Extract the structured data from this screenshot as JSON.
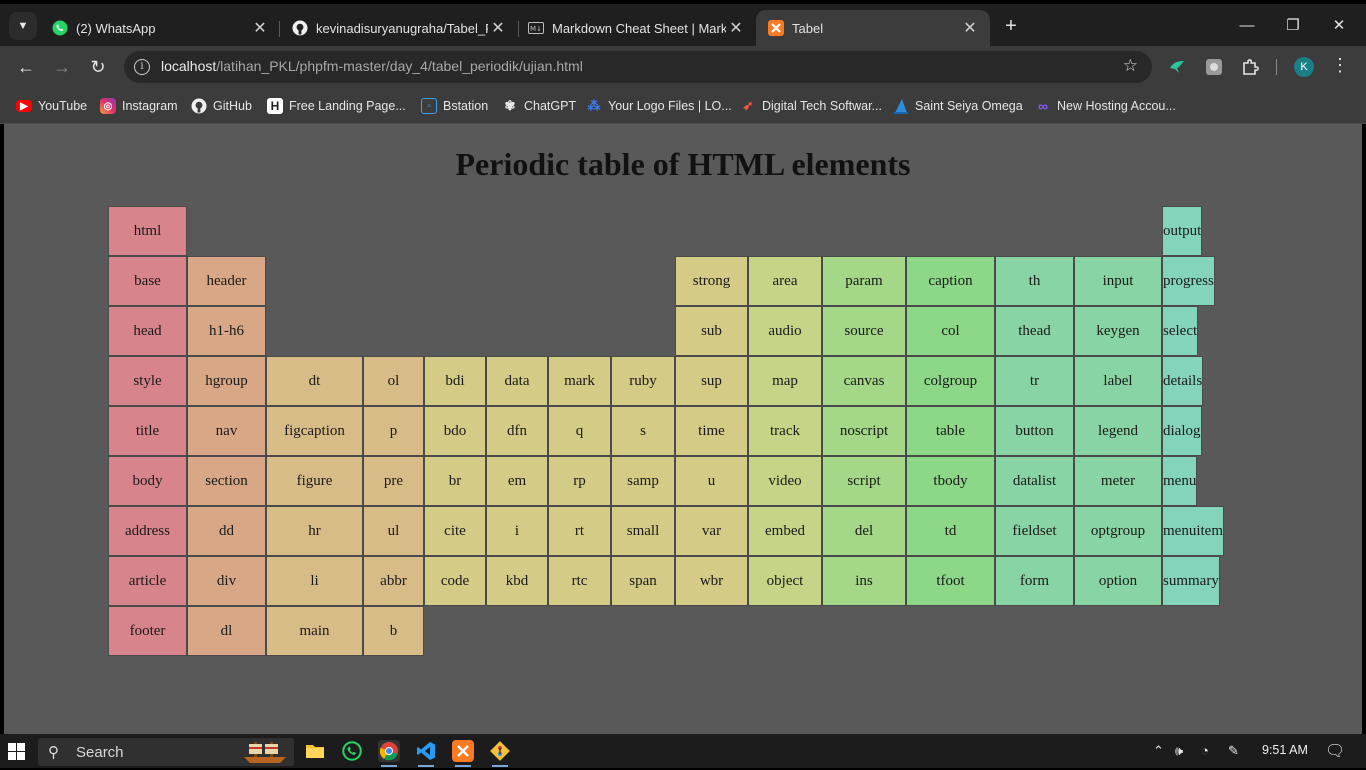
{
  "browser": {
    "tabs": [
      {
        "title": "(2) WhatsApp",
        "icon": "whatsapp-icon",
        "active": false
      },
      {
        "title": "kevinadisuryanugraha/Tabel_Pe",
        "icon": "github-icon",
        "active": false
      },
      {
        "title": "Markdown Cheat Sheet | Markd",
        "icon": "markdown-icon",
        "active": false
      },
      {
        "title": "Tabel",
        "icon": "xampp-icon",
        "active": true
      }
    ],
    "url_host": "localhost",
    "url_path": "/latihan_PKL/phpfm-master/day_4/tabel_periodik/ujian.html",
    "profile_initial": "K",
    "bookmarks": [
      {
        "label": "YouTube",
        "icon": "youtube-icon"
      },
      {
        "label": "Instagram",
        "icon": "instagram-icon"
      },
      {
        "label": "GitHub",
        "icon": "github-icon"
      },
      {
        "label": "Free Landing Page...",
        "icon": "h-icon"
      },
      {
        "label": "Bstation",
        "icon": "bstation-icon"
      },
      {
        "label": "ChatGPT",
        "icon": "chatgpt-icon"
      },
      {
        "label": "Your Logo Files | LO...",
        "icon": "logo-files-icon"
      },
      {
        "label": "Digital Tech Softwar...",
        "icon": "rocket-icon"
      },
      {
        "label": "Saint Seiya Omega",
        "icon": "sail-icon"
      },
      {
        "label": "New Hosting Accou...",
        "icon": "infinity-icon"
      }
    ]
  },
  "page": {
    "title": "Periodic table of HTML elements",
    "elements": [
      {
        "label": "html",
        "col": 0,
        "row": 0
      },
      {
        "label": "output",
        "col": 13,
        "row": 0
      },
      {
        "label": "base",
        "col": 0,
        "row": 1
      },
      {
        "label": "header",
        "col": 1,
        "row": 1
      },
      {
        "label": "strong",
        "col": 8,
        "row": 1
      },
      {
        "label": "area",
        "col": 9,
        "row": 1
      },
      {
        "label": "param",
        "col": 10,
        "row": 1
      },
      {
        "label": "caption",
        "col": 11,
        "row": 1
      },
      {
        "label": "th",
        "col": 12,
        "row": 1
      },
      {
        "label": "input",
        "col": 12.5,
        "row": 1
      },
      {
        "label": "progress",
        "col": 13,
        "row": 1
      },
      {
        "label": "head",
        "col": 0,
        "row": 2
      },
      {
        "label": "h1-h6",
        "col": 1,
        "row": 2
      },
      {
        "label": "sub",
        "col": 8,
        "row": 2
      },
      {
        "label": "audio",
        "col": 9,
        "row": 2
      },
      {
        "label": "source",
        "col": 10,
        "row": 2
      },
      {
        "label": "col",
        "col": 11,
        "row": 2
      },
      {
        "label": "thead",
        "col": 12,
        "row": 2
      },
      {
        "label": "keygen",
        "col": 12.5,
        "row": 2
      },
      {
        "label": "select",
        "col": 13,
        "row": 2
      },
      {
        "label": "style",
        "col": 0,
        "row": 3
      },
      {
        "label": "hgroup",
        "col": 1,
        "row": 3
      },
      {
        "label": "dt",
        "col": 2,
        "row": 3
      },
      {
        "label": "ol",
        "col": 3,
        "row": 3
      },
      {
        "label": "bdi",
        "col": 4,
        "row": 3
      },
      {
        "label": "data",
        "col": 5,
        "row": 3
      },
      {
        "label": "mark",
        "col": 6,
        "row": 3
      },
      {
        "label": "ruby",
        "col": 7,
        "row": 3
      },
      {
        "label": "sup",
        "col": 8,
        "row": 3
      },
      {
        "label": "map",
        "col": 9,
        "row": 3
      },
      {
        "label": "canvas",
        "col": 10,
        "row": 3
      },
      {
        "label": "colgroup",
        "col": 11,
        "row": 3
      },
      {
        "label": "tr",
        "col": 12,
        "row": 3
      },
      {
        "label": "label",
        "col": 12.5,
        "row": 3
      },
      {
        "label": "details",
        "col": 13,
        "row": 3
      },
      {
        "label": "title",
        "col": 0,
        "row": 4
      },
      {
        "label": "nav",
        "col": 1,
        "row": 4
      },
      {
        "label": "figcaption",
        "col": 2,
        "row": 4
      },
      {
        "label": "p",
        "col": 3,
        "row": 4
      },
      {
        "label": "bdo",
        "col": 4,
        "row": 4
      },
      {
        "label": "dfn",
        "col": 5,
        "row": 4
      },
      {
        "label": "q",
        "col": 6,
        "row": 4
      },
      {
        "label": "s",
        "col": 7,
        "row": 4
      },
      {
        "label": "time",
        "col": 8,
        "row": 4
      },
      {
        "label": "track",
        "col": 9,
        "row": 4
      },
      {
        "label": "noscript",
        "col": 10,
        "row": 4
      },
      {
        "label": "table",
        "col": 11,
        "row": 4
      },
      {
        "label": "button",
        "col": 12,
        "row": 4
      },
      {
        "label": "legend",
        "col": 12.5,
        "row": 4
      },
      {
        "label": "dialog",
        "col": 13,
        "row": 4
      },
      {
        "label": "body",
        "col": 0,
        "row": 5
      },
      {
        "label": "section",
        "col": 1,
        "row": 5
      },
      {
        "label": "figure",
        "col": 2,
        "row": 5
      },
      {
        "label": "pre",
        "col": 3,
        "row": 5
      },
      {
        "label": "br",
        "col": 4,
        "row": 5
      },
      {
        "label": "em",
        "col": 5,
        "row": 5
      },
      {
        "label": "rp",
        "col": 6,
        "row": 5
      },
      {
        "label": "samp",
        "col": 7,
        "row": 5
      },
      {
        "label": "u",
        "col": 8,
        "row": 5
      },
      {
        "label": "video",
        "col": 9,
        "row": 5
      },
      {
        "label": "script",
        "col": 10,
        "row": 5
      },
      {
        "label": "tbody",
        "col": 11,
        "row": 5
      },
      {
        "label": "datalist",
        "col": 12,
        "row": 5
      },
      {
        "label": "meter",
        "col": 12.5,
        "row": 5
      },
      {
        "label": "menu",
        "col": 13,
        "row": 5
      },
      {
        "label": "address",
        "col": 0,
        "row": 6
      },
      {
        "label": "dd",
        "col": 1,
        "row": 6
      },
      {
        "label": "hr",
        "col": 2,
        "row": 6
      },
      {
        "label": "ul",
        "col": 3,
        "row": 6
      },
      {
        "label": "cite",
        "col": 4,
        "row": 6
      },
      {
        "label": "i",
        "col": 5,
        "row": 6
      },
      {
        "label": "rt",
        "col": 6,
        "row": 6
      },
      {
        "label": "small",
        "col": 7,
        "row": 6
      },
      {
        "label": "var",
        "col": 8,
        "row": 6
      },
      {
        "label": "embed",
        "col": 9,
        "row": 6
      },
      {
        "label": "del",
        "col": 10,
        "row": 6
      },
      {
        "label": "td",
        "col": 11,
        "row": 6
      },
      {
        "label": "fieldset",
        "col": 12,
        "row": 6
      },
      {
        "label": "optgroup",
        "col": 12.5,
        "row": 6
      },
      {
        "label": "menuitem",
        "col": 13,
        "row": 6
      },
      {
        "label": "article",
        "col": 0,
        "row": 7
      },
      {
        "label": "div",
        "col": 1,
        "row": 7
      },
      {
        "label": "li",
        "col": 2,
        "row": 7
      },
      {
        "label": "abbr",
        "col": 3,
        "row": 7
      },
      {
        "label": "code",
        "col": 4,
        "row": 7
      },
      {
        "label": "kbd",
        "col": 5,
        "row": 7
      },
      {
        "label": "rtc",
        "col": 6,
        "row": 7
      },
      {
        "label": "span",
        "col": 7,
        "row": 7
      },
      {
        "label": "wbr",
        "col": 8,
        "row": 7
      },
      {
        "label": "object",
        "col": 9,
        "row": 7
      },
      {
        "label": "ins",
        "col": 10,
        "row": 7
      },
      {
        "label": "tfoot",
        "col": 11,
        "row": 7
      },
      {
        "label": "form",
        "col": 12,
        "row": 7
      },
      {
        "label": "option",
        "col": 12.5,
        "row": 7
      },
      {
        "label": "summary",
        "col": 13,
        "row": 7
      },
      {
        "label": "footer",
        "col": 0,
        "row": 8
      },
      {
        "label": "dl",
        "col": 1,
        "row": 8
      },
      {
        "label": "main",
        "col": 2,
        "row": 8
      },
      {
        "label": "b",
        "col": 3,
        "row": 8
      }
    ]
  },
  "taskbar": {
    "search_label": "Search",
    "time": "9:51 AM",
    "apps": [
      "file-explorer-icon",
      "whatsapp-icon",
      "chrome-icon",
      "vscode-icon",
      "xampp-icon",
      "git-icon"
    ]
  },
  "colors": {
    "page_bg": "#595959",
    "cell_border": "#4a4a4a",
    "cell_colors": [
      "#d8848c",
      "#d8a886",
      "#d8bc88",
      "#d4cb86",
      "#c6d488",
      "#a4d888",
      "#8cd888",
      "#88d4a4",
      "#84d4bc"
    ]
  }
}
